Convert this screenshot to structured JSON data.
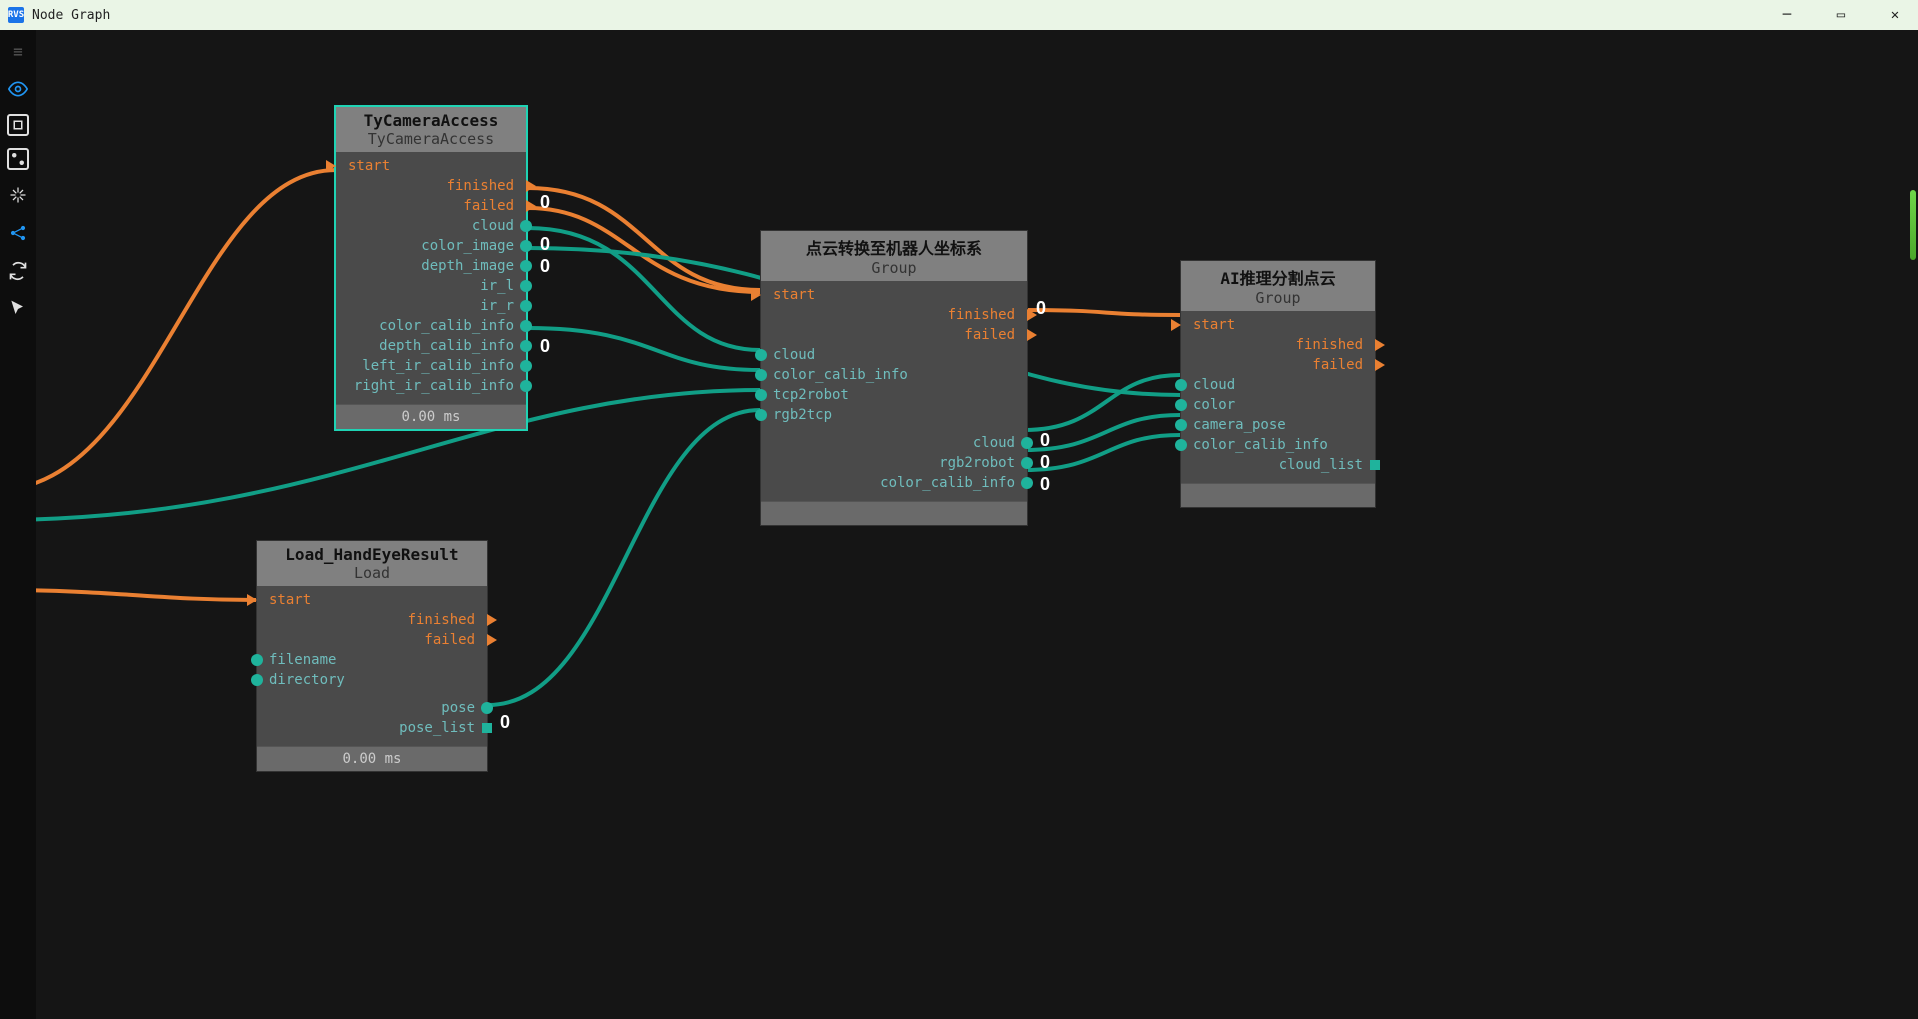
{
  "window": {
    "title": "Node Graph",
    "appicon": "RVS"
  },
  "nodes": {
    "camera": {
      "title": "TyCameraAccess",
      "subtitle": "TyCameraAccess",
      "footer": "0.00 ms",
      "inputs": {
        "start": "start"
      },
      "outputs": {
        "finished": "finished",
        "failed": "failed",
        "cloud": "cloud",
        "color_image": "color_image",
        "depth_image": "depth_image",
        "ir_l": "ir_l",
        "ir_r": "ir_r",
        "color_calib_info": "color_calib_info",
        "depth_calib_info": "depth_calib_info",
        "left_ir_calib_info": "left_ir_calib_info",
        "right_ir_calib_info": "right_ir_calib_info"
      }
    },
    "load": {
      "title": "Load_HandEyeResult",
      "subtitle": "Load",
      "footer": "0.00 ms",
      "inputs": {
        "start": "start",
        "filename": "filename",
        "directory": "directory"
      },
      "outputs": {
        "finished": "finished",
        "failed": "failed",
        "pose": "pose",
        "pose_list": "pose_list"
      }
    },
    "convert": {
      "title": "点云转换至机器人坐标系",
      "subtitle": "Group",
      "inputs": {
        "start": "start",
        "cloud": "cloud",
        "color_calib_info": "color_calib_info",
        "tcp2robot": "tcp2robot",
        "rgb2tcp": "rgb2tcp"
      },
      "outputs": {
        "finished": "finished",
        "failed": "failed",
        "cloud": "cloud",
        "rgb2robot": "rgb2robot",
        "color_calib_info": "color_calib_info"
      }
    },
    "ai": {
      "title": "AI推理分割点云",
      "subtitle": "Group",
      "inputs": {
        "start": "start",
        "cloud": "cloud",
        "color": "color",
        "camera_pose": "camera_pose",
        "color_calib_info": "color_calib_info"
      },
      "outputs": {
        "finished": "finished",
        "failed": "failed",
        "cloud_list": "cloud_list"
      }
    }
  },
  "badges": {
    "b0": "0",
    "b1": "0",
    "b2": "0",
    "b3": "0",
    "b4": "0",
    "b5": "0",
    "b6": "0",
    "b7": "0",
    "b8": "0"
  }
}
